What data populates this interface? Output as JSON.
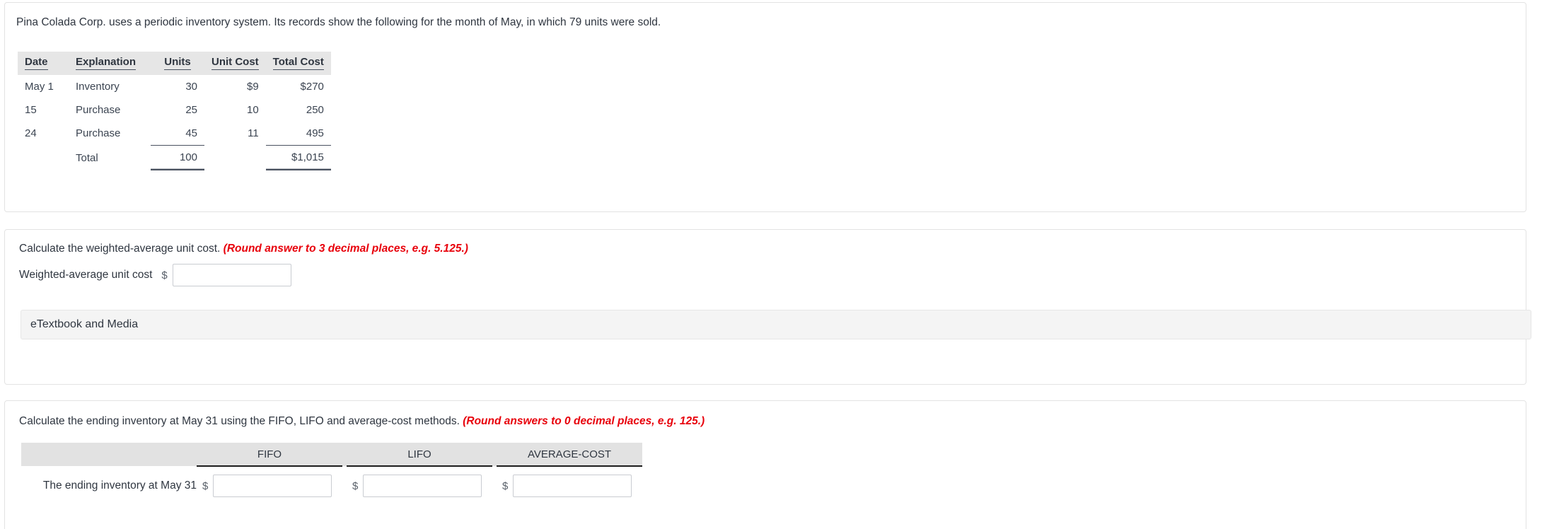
{
  "problem": {
    "statement": "Pina Colada Corp. uses a periodic inventory system. Its records show the following for the month of May, in which 79 units were sold.",
    "table": {
      "headers": [
        "Date",
        "Explanation",
        "Units",
        "Unit Cost",
        "Total Cost"
      ],
      "rows": [
        {
          "date": "May 1",
          "explanation": "Inventory",
          "units": "30",
          "unit_cost": "$9",
          "total_cost": "$270"
        },
        {
          "date": "15",
          "explanation": "Purchase",
          "units": "25",
          "unit_cost": "10",
          "total_cost": "250"
        },
        {
          "date": "24",
          "explanation": "Purchase",
          "units": "45",
          "unit_cost": "11",
          "total_cost": "495"
        }
      ],
      "total_row": {
        "date": "",
        "explanation": "Total",
        "units": "100",
        "unit_cost": "",
        "total_cost": "$1,015"
      }
    }
  },
  "weighted_average": {
    "prompt": "Calculate the weighted-average unit cost.",
    "hint": "(Round answer to 3 decimal places, e.g. 5.125.)",
    "field_label": "Weighted-average unit cost",
    "currency_symbol": "$",
    "value": "",
    "placeholder": ""
  },
  "etextbook": {
    "label": "eTextbook and Media"
  },
  "methods": {
    "prompt": "Calculate the ending inventory at May 31 using the FIFO, LIFO and average-cost methods.",
    "hint": "(Round answers to 0 decimal places, e.g. 125.)",
    "columns": [
      "FIFO",
      "LIFO",
      "AVERAGE-COST"
    ],
    "row_label": "The ending inventory at May 31",
    "currency_symbol": "$",
    "values": [
      "",
      "",
      ""
    ],
    "placeholder": ""
  },
  "colors": {
    "hint_red": "#e8000b",
    "header_gray": "#e6e6e6",
    "card_border": "#e3e3e3",
    "text": "#2f3640"
  }
}
